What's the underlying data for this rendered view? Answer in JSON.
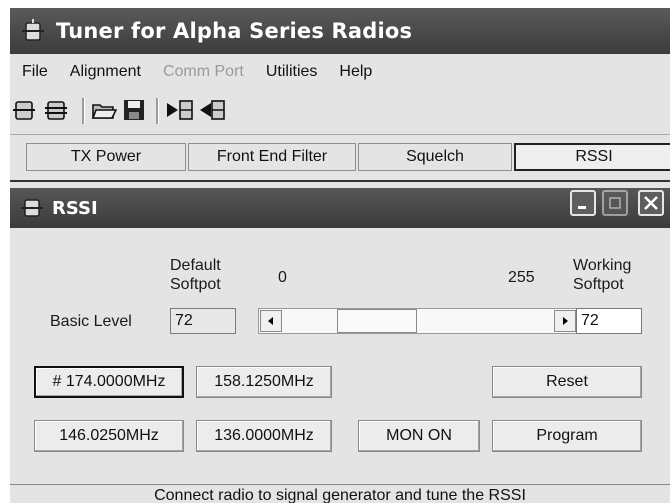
{
  "window": {
    "title": "Tuner for Alpha Series Radios"
  },
  "menu": [
    "File",
    "Alignment",
    "Comm Port",
    "Utilities",
    "Help"
  ],
  "menu_disabled": [
    "Comm Port"
  ],
  "toolbar": {
    "buttons": [
      "radio-icon",
      "radio-read-icon",
      "open-folder-icon",
      "save-disk-icon",
      "write-to-radio-icon",
      "read-from-radio-icon"
    ]
  },
  "tabs": [
    "TX Power",
    "Front End Filter",
    "Squelch",
    "RSSI"
  ],
  "active_tab": "RSSI",
  "child": {
    "title": "RSSI",
    "default_softpot_label": "Default\nSoftpot",
    "range_min": "0",
    "range_max": "255",
    "working_softpot_label": "Working\nSoftpot",
    "row_label": "Basic Level",
    "default_value": "72",
    "working_value": "72",
    "slider_value": 72,
    "slider_min": 0,
    "slider_max": 255,
    "freq_buttons": [
      "# 174.0000MHz",
      "158.1250MHz",
      "146.0250MHz",
      "136.0000MHz"
    ],
    "mon_button": "MON ON",
    "reset_button": "Reset",
    "program_button": "Program",
    "status": "Connect radio to signal generator and tune the RSSI"
  }
}
